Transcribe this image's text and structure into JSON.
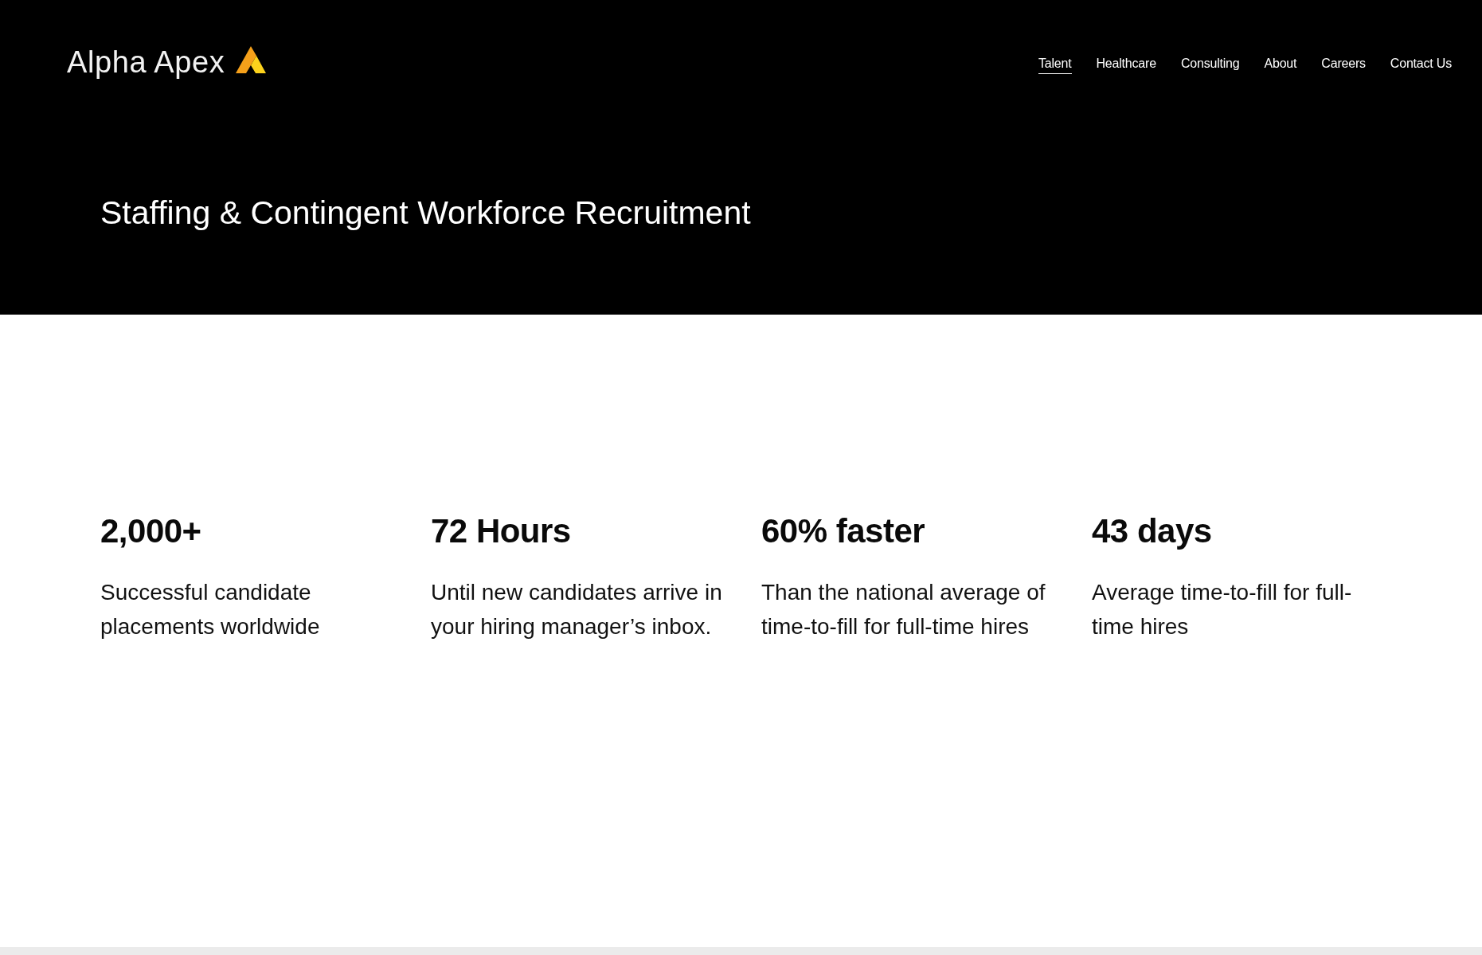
{
  "header": {
    "logo": {
      "text": "Alpha Apex"
    },
    "nav": [
      {
        "label": "Talent",
        "selected": true
      },
      {
        "label": "Healthcare",
        "selected": false
      },
      {
        "label": "Consulting",
        "selected": false
      },
      {
        "label": "About",
        "selected": false
      },
      {
        "label": "Careers",
        "selected": false
      },
      {
        "label": "Contact Us",
        "selected": false
      }
    ]
  },
  "hero": {
    "title": "Staffing & Contingent Workforce Recruitment"
  },
  "stats": [
    {
      "value": "2,000+",
      "description": "Successful candidate placements worldwide"
    },
    {
      "value": "72 Hours",
      "description": "Until new candidates arrive in your hiring manager’s inbox."
    },
    {
      "value": "60% faster",
      "description": "Than the national average of time-to-fill for full-time hires"
    },
    {
      "value": "43 days",
      "description": "Average time-to-fill for full-time hires"
    }
  ]
}
